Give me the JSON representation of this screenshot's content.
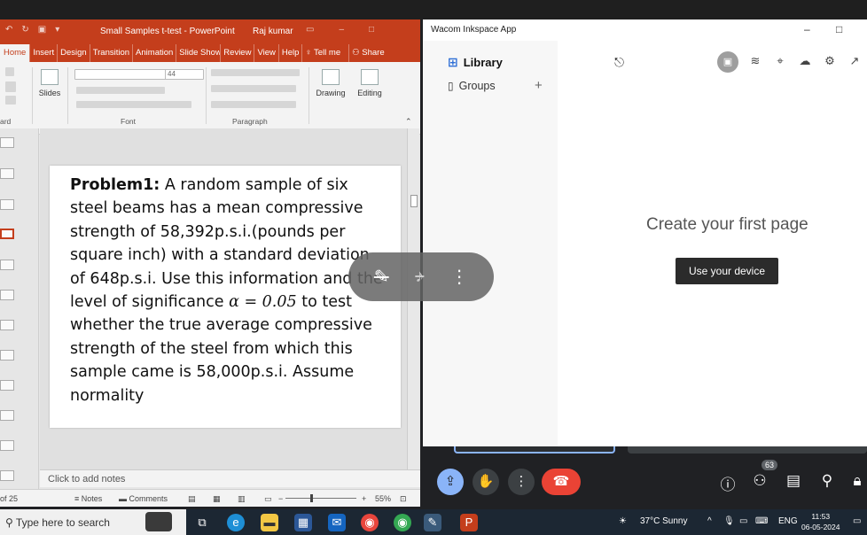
{
  "powerpoint": {
    "title": "Small Samples t-test  -  PowerPoint",
    "user": "Raj kumar",
    "tabs": [
      "Home",
      "Insert",
      "Design",
      "Transition",
      "Animation",
      "Slide Show",
      "Review",
      "View",
      "Help"
    ],
    "tell_me": "Tell me",
    "share": "Share",
    "ribbon": {
      "slides_label": "Slides",
      "font_label": "Font",
      "paragraph_label": "Paragraph",
      "clipboard_label": "ard",
      "drawing_label": "Drawing",
      "editing_label": "Editing",
      "font_size": "44"
    },
    "slide": {
      "bold_lead": "Problem1:",
      "text_1": " A random sample of six steel beams has a mean compressive strength of 58,392p.s.i.(pounds per square inch) with a standard deviation of 648p.s.i. Use this information and the level of significance ",
      "alpha": "α = 0.05",
      "text_2": " to test whether the true average compressive strength of the steel from which this sample came is 58,000p.s.i. Assume normality"
    },
    "notes_placeholder": "Click to add notes",
    "status": {
      "slide_of": "of 25",
      "notes": "Notes",
      "comments": "Comments",
      "zoom": "55%"
    }
  },
  "wacom": {
    "title": "Wacom Inkspace App",
    "library": "Library",
    "groups": "Groups",
    "empty_title": "Create your first page",
    "use_device": "Use your device"
  },
  "meet": {
    "participants": "63"
  },
  "taskbar": {
    "search_placeholder": "Type here to search",
    "weather": "37°C  Sunny",
    "language": "ENG",
    "time": "11:53",
    "date": "06-05-2024"
  },
  "colors": {
    "ppt_accent": "#c43e1c",
    "meet_end": "#ea4335",
    "meet_active": "#8ab4f8"
  }
}
